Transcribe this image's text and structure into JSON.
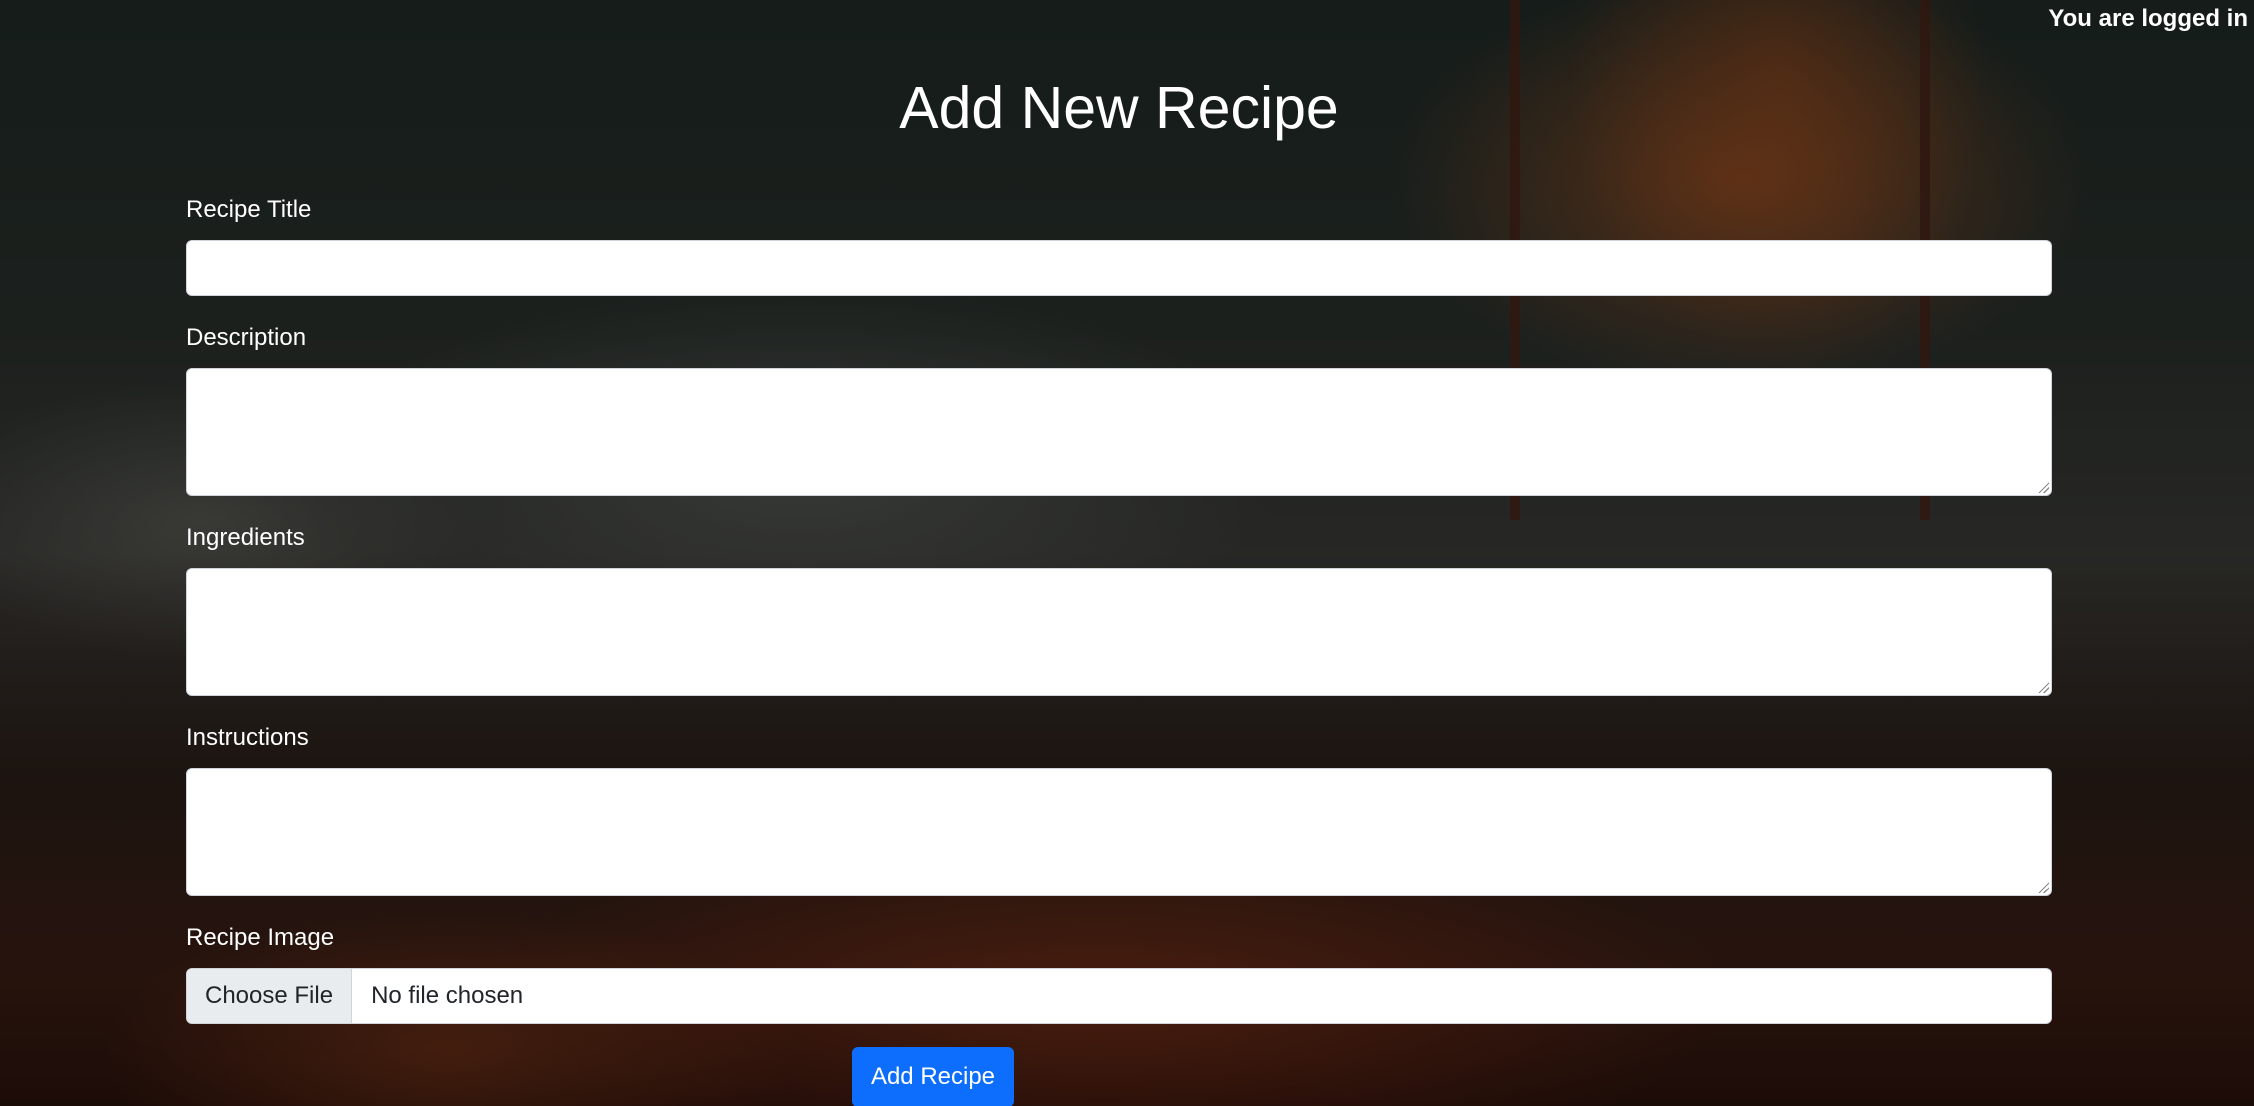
{
  "header": {
    "login_status": "You are logged in"
  },
  "page": {
    "title": "Add New Recipe"
  },
  "form": {
    "title_label": "Recipe Title",
    "title_value": "",
    "description_label": "Description",
    "description_value": "",
    "ingredients_label": "Ingredients",
    "ingredients_value": "",
    "instructions_label": "Instructions",
    "instructions_value": "",
    "image_label": "Recipe Image",
    "file_button_label": "Choose File",
    "file_status": "No file chosen",
    "submit_label": "Add Recipe"
  },
  "colors": {
    "submit_button": "#0d6efd",
    "text": "#ffffff"
  }
}
